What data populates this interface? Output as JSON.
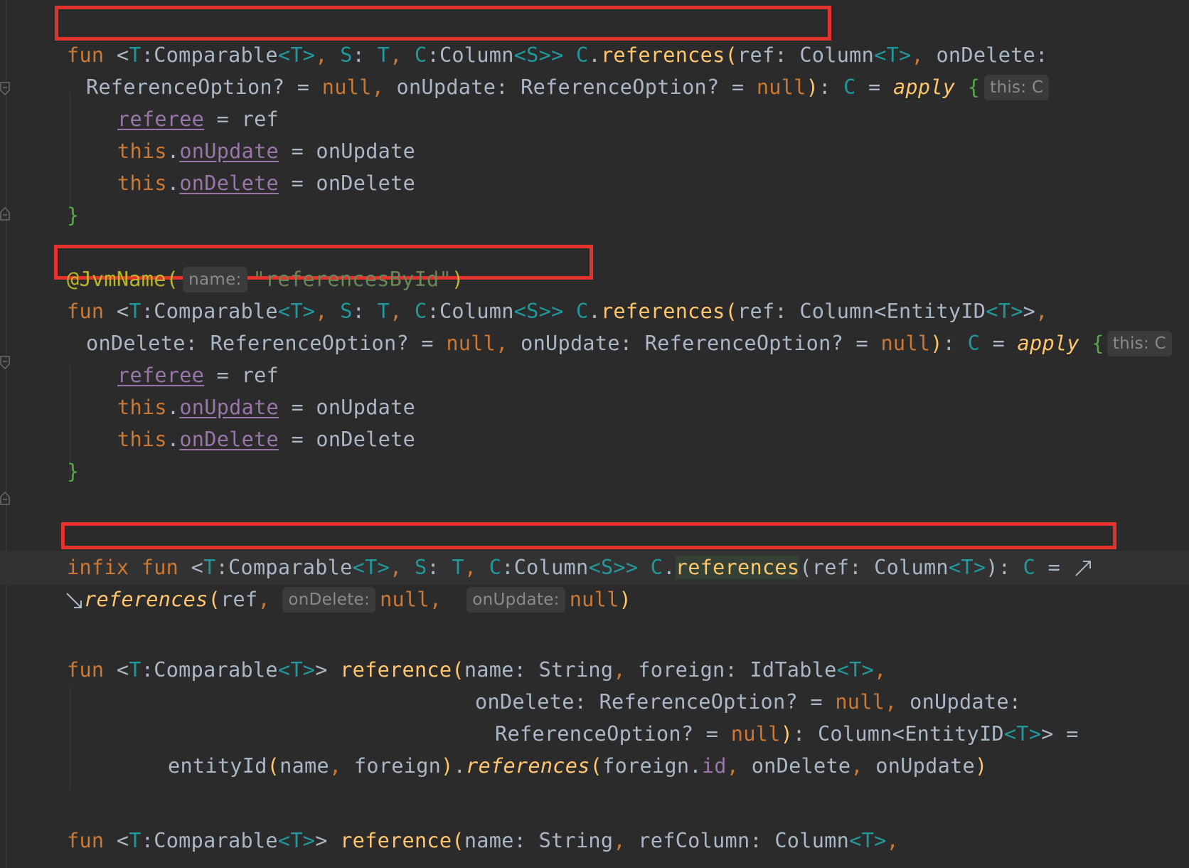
{
  "code": {
    "kw_fun": "fun",
    "kw_infix": "infix",
    "kw_this": "this",
    "kw_null": "null",
    "tp_T": "T",
    "tp_S": "S",
    "tp_C": "C",
    "comparable": "Comparable",
    "column": "Column",
    "entity_id": "EntityID",
    "reference_option": "ReferenceOption",
    "id_table": "IdTable",
    "string_type": "String",
    "fn_references": "references",
    "fn_reference": "reference",
    "fn_apply": "apply",
    "fn_entity_id": "entityId",
    "p_ref": "ref",
    "p_on_delete": "onDelete",
    "p_on_update": "onUpdate",
    "p_name": "name",
    "p_foreign": "foreign",
    "p_ref_column": "refColumn",
    "prop_referee": "referee",
    "prop_on_update": "onUpdate",
    "prop_on_delete": "onDelete",
    "prop_id": "id",
    "annotation": "@JvmName",
    "string_literal": "\"referencesById\""
  },
  "hints": {
    "this_c": "this: C",
    "this_partial": "this: C",
    "name": "name:",
    "on_delete": "onDelete:",
    "on_update": "onUpdate:"
  },
  "colors": {
    "background": "#2b2b2b",
    "keyword": "#cc7832",
    "type_param": "#20999d",
    "function": "#ffc66d",
    "property": "#9876aa",
    "string": "#6a8759",
    "annotation": "#bbb529",
    "highlight_box": "#e5322d"
  }
}
